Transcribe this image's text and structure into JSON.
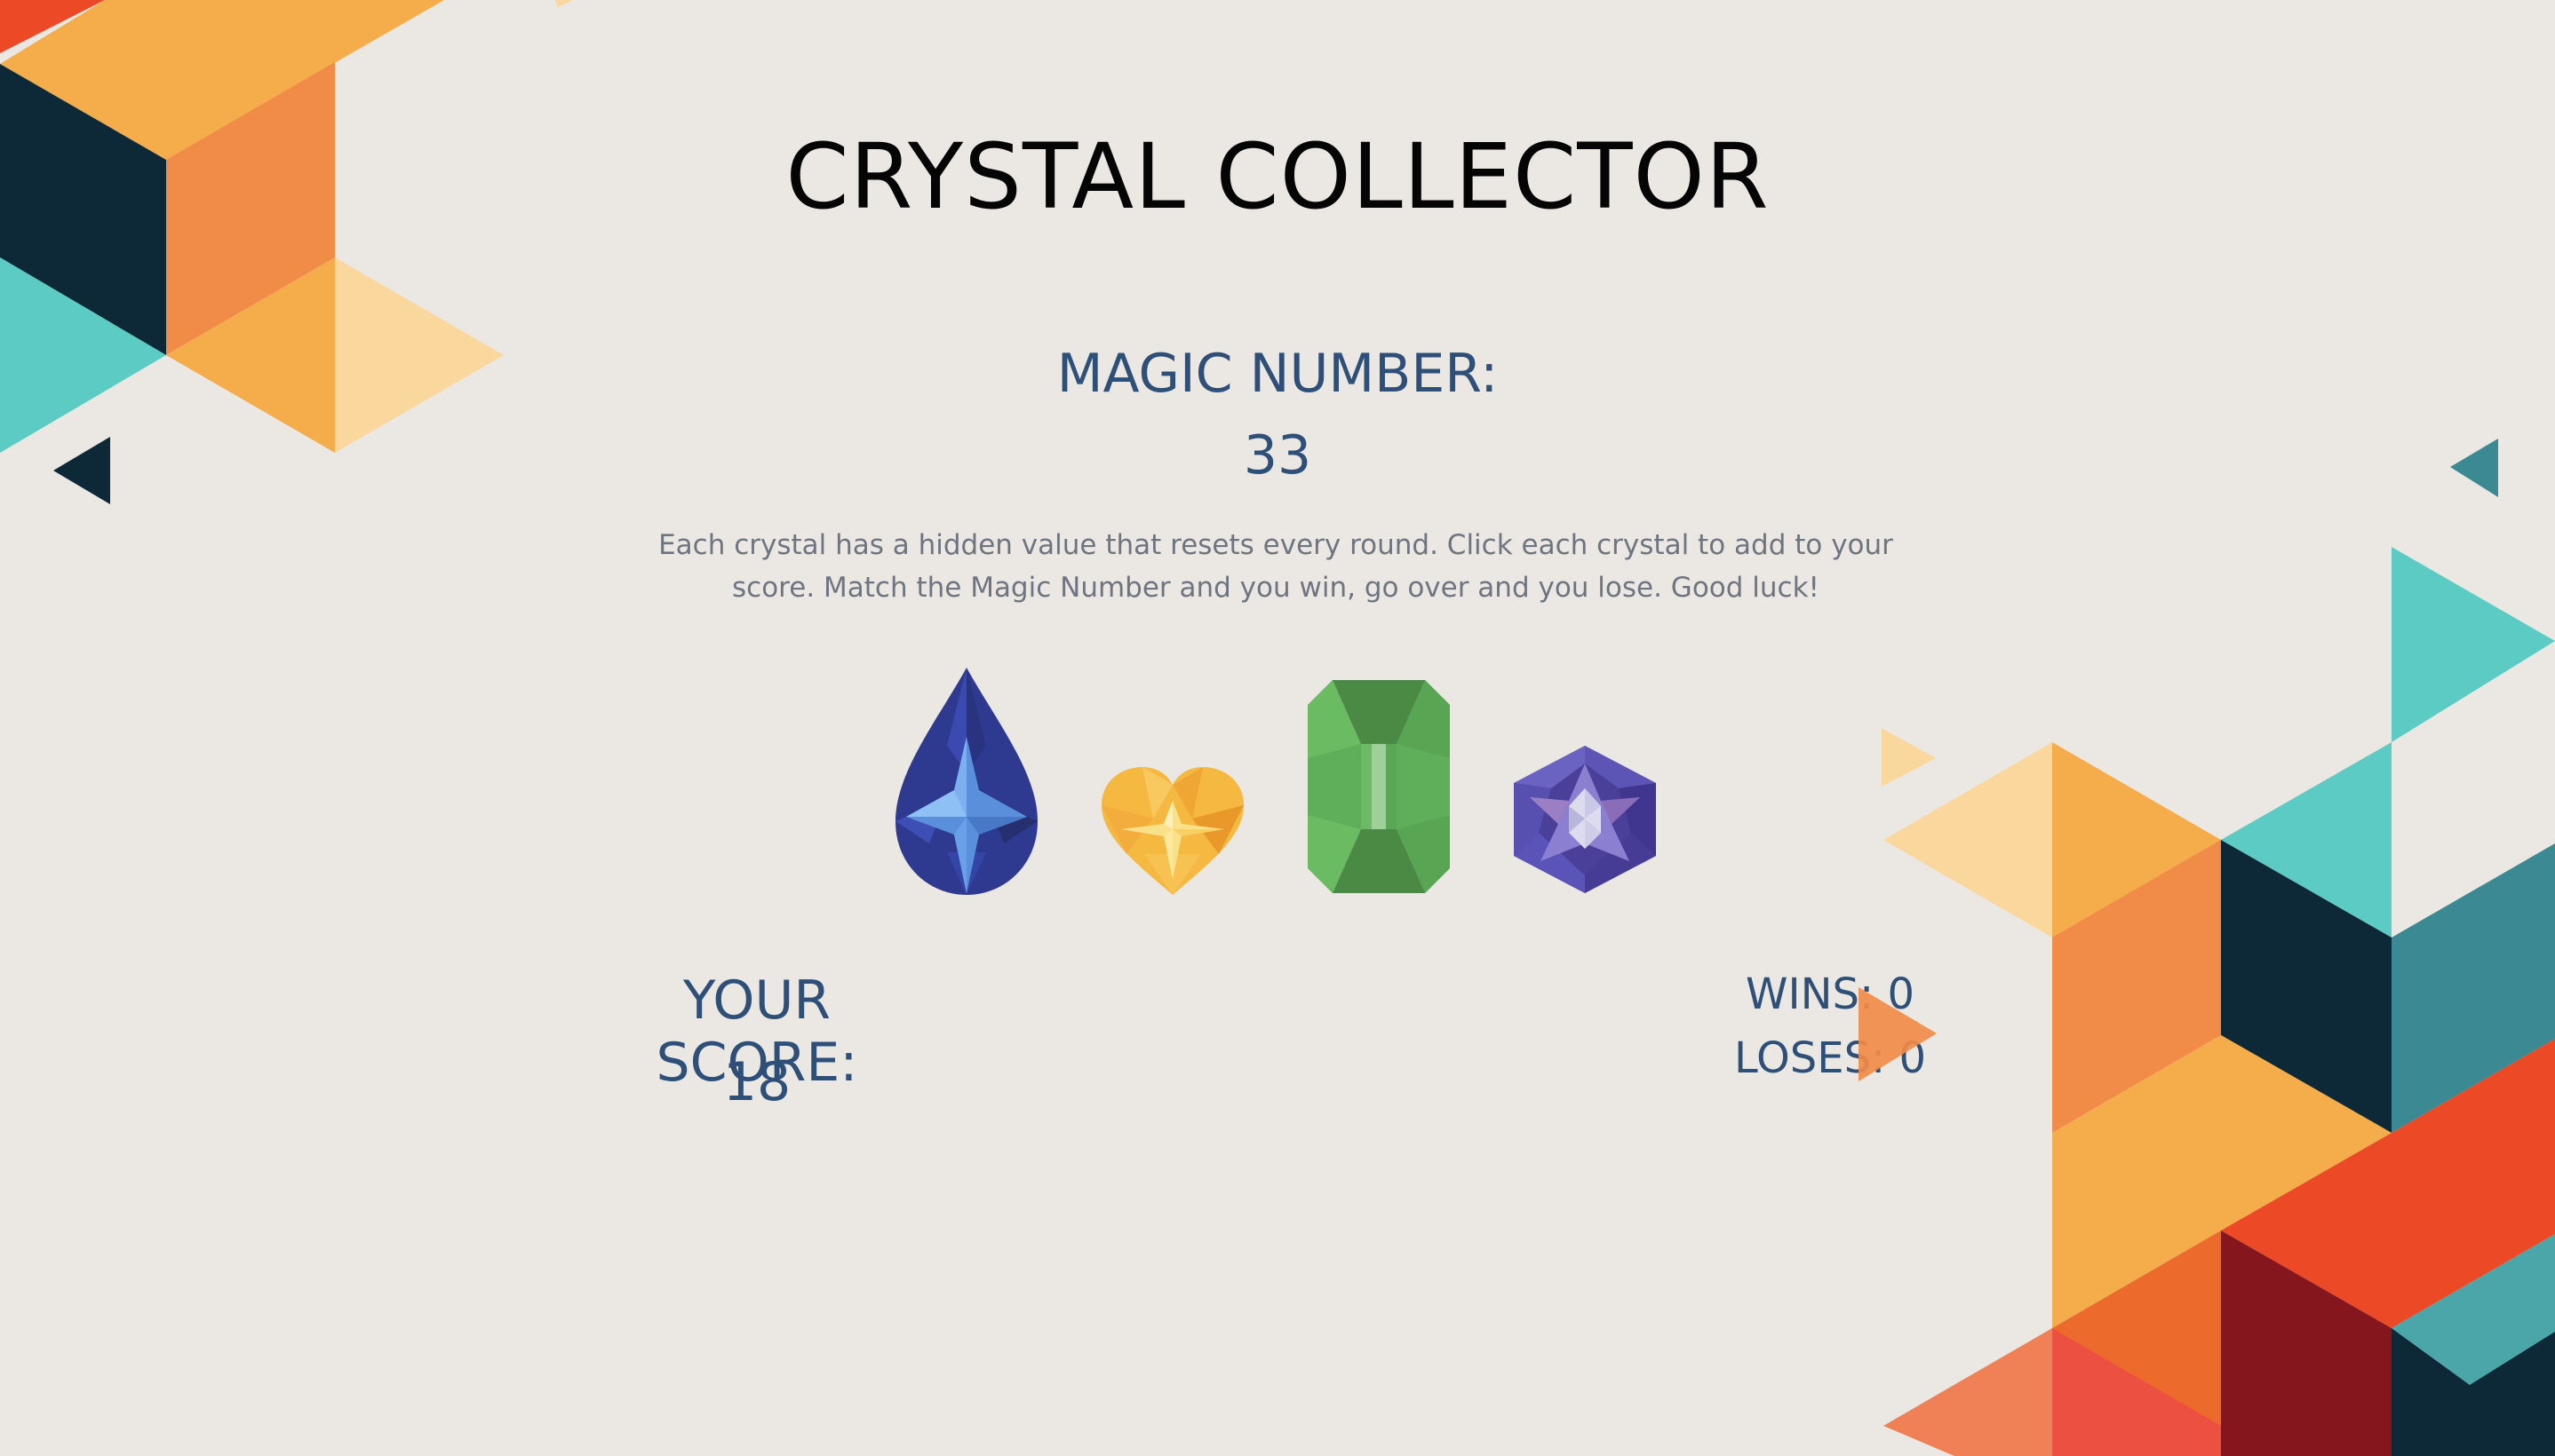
{
  "game": {
    "title": "CRYSTAL COLLECTOR",
    "magic_label": "MAGIC NUMBER:",
    "magic_number": "33",
    "instructions": "Each crystal has a hidden value that resets every round. Click each crystal to add to your score. Match the Magic Number and you win, go over and you lose. Good luck!",
    "score_label": "YOUR SCORE:",
    "score_value": "18",
    "wins_text": "WINS: 0",
    "loses_text": "LOSES: 0"
  },
  "crystals": [
    {
      "name": "blue-teardrop-crystal",
      "color": "#2f3a8f"
    },
    {
      "name": "yellow-heart-crystal",
      "color": "#f5b942"
    },
    {
      "name": "green-emerald-crystal",
      "color": "#5fae5a"
    },
    {
      "name": "purple-hexagon-crystal",
      "color": "#4a3f99"
    }
  ],
  "palette": {
    "background": "#ebe8e4",
    "navy": "#0d2836",
    "orange": "#f08b48",
    "amber": "#f4ad4a",
    "peach": "#fad79c",
    "teal": "#5ccbc3",
    "dark_teal": "#3b8a93",
    "red": "#ec4a27",
    "maroon": "#85161e",
    "text_blue": "#2d4f78"
  }
}
